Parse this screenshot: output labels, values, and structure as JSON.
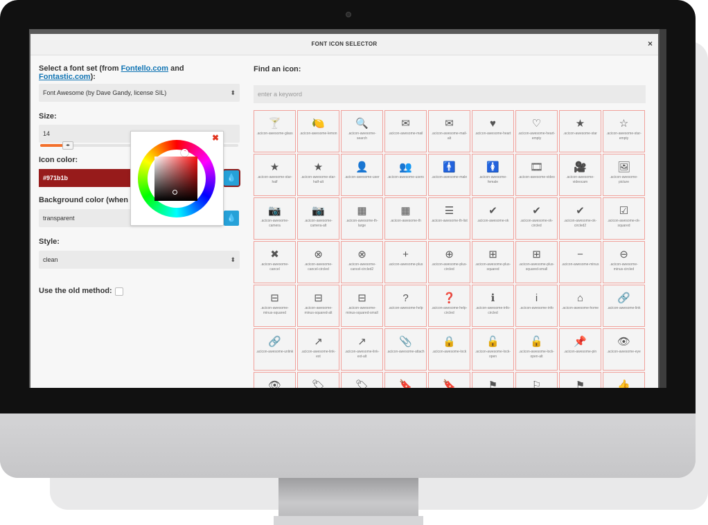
{
  "dialog": {
    "title": "FONT ICON SELECTOR",
    "close_glyph": "×"
  },
  "font_set": {
    "label_prefix": "Select a font set (from ",
    "link1": "Fontello.com",
    "label_mid": " and ",
    "link2": "Fontastic.com",
    "label_suffix": "):",
    "value": "Font Awesome (by Dave Gandy, license SIL)"
  },
  "size": {
    "label": "Size:",
    "value": "14",
    "slider_fraction": 0.15,
    "handle_glyph": "◂▸"
  },
  "icon_color": {
    "label": "Icon color:",
    "value": "#971b1b",
    "button_icon": "droplet-icon",
    "button_glyph": "💧"
  },
  "background_color": {
    "label": "Background color (when available):",
    "value": "transparent",
    "button_glyph": "💧"
  },
  "style": {
    "label": "Style:",
    "value": "clean"
  },
  "old_method": {
    "label": "Use the old method:",
    "checked": false
  },
  "picker": {
    "close_glyph": "✖"
  },
  "find": {
    "label": "Find an icon:",
    "placeholder": "enter a keyword"
  },
  "icons": [
    {
      "glyph": "🍸",
      "name": "glass"
    },
    {
      "glyph": "🍋",
      "name": "lemon"
    },
    {
      "glyph": "🔍",
      "name": "search"
    },
    {
      "glyph": "✉",
      "name": "mail"
    },
    {
      "glyph": "✉",
      "name": "mail-alt"
    },
    {
      "glyph": "♥",
      "name": "heart"
    },
    {
      "glyph": "♡",
      "name": "heart-empty"
    },
    {
      "glyph": "★",
      "name": "star"
    },
    {
      "glyph": "☆",
      "name": "star-empty"
    },
    {
      "glyph": "★",
      "name": "star-half"
    },
    {
      "glyph": "★",
      "name": "star-half-alt"
    },
    {
      "glyph": "👤",
      "name": "user"
    },
    {
      "glyph": "👥",
      "name": "users"
    },
    {
      "glyph": "🚹",
      "name": "male"
    },
    {
      "glyph": "🚺",
      "name": "female"
    },
    {
      "glyph": "🎞",
      "name": "video"
    },
    {
      "glyph": "🎥",
      "name": "videocam"
    },
    {
      "glyph": "🖼",
      "name": "picture"
    },
    {
      "glyph": "📷",
      "name": "camera"
    },
    {
      "glyph": "📷",
      "name": "camera-alt"
    },
    {
      "glyph": "▦",
      "name": "th-large"
    },
    {
      "glyph": "▦",
      "name": "th"
    },
    {
      "glyph": "☰",
      "name": "th-list"
    },
    {
      "glyph": "✔",
      "name": "ok"
    },
    {
      "glyph": "✔",
      "name": "ok-circled"
    },
    {
      "glyph": "✔",
      "name": "ok-circled2"
    },
    {
      "glyph": "☑",
      "name": "ok-squared"
    },
    {
      "glyph": "✖",
      "name": "cancel"
    },
    {
      "glyph": "⊗",
      "name": "cancel-circled"
    },
    {
      "glyph": "⊗",
      "name": "cancel-circled2"
    },
    {
      "glyph": "+",
      "name": "plus"
    },
    {
      "glyph": "⊕",
      "name": "plus-circled"
    },
    {
      "glyph": "⊞",
      "name": "plus-squared"
    },
    {
      "glyph": "⊞",
      "name": "plus-squared-small"
    },
    {
      "glyph": "−",
      "name": "minus"
    },
    {
      "glyph": "⊖",
      "name": "minus-circled"
    },
    {
      "glyph": "⊟",
      "name": "minus-squared"
    },
    {
      "glyph": "⊟",
      "name": "minus-squared-alt"
    },
    {
      "glyph": "⊟",
      "name": "minus-squared-small"
    },
    {
      "glyph": "?",
      "name": "help"
    },
    {
      "glyph": "❓",
      "name": "help-circled"
    },
    {
      "glyph": "ℹ",
      "name": "info-circled"
    },
    {
      "glyph": "i",
      "name": "info"
    },
    {
      "glyph": "⌂",
      "name": "home"
    },
    {
      "glyph": "🔗",
      "name": "link"
    },
    {
      "glyph": "🔗",
      "name": "unlink"
    },
    {
      "glyph": "↗",
      "name": "link-ext"
    },
    {
      "glyph": "↗",
      "name": "link-ext-alt"
    },
    {
      "glyph": "📎",
      "name": "attach"
    },
    {
      "glyph": "🔒",
      "name": "lock"
    },
    {
      "glyph": "🔓",
      "name": "lock-open"
    },
    {
      "glyph": "🔓",
      "name": "lock-open-alt"
    },
    {
      "glyph": "📌",
      "name": "pin"
    },
    {
      "glyph": "👁",
      "name": "eye"
    },
    {
      "glyph": "👁",
      "name": ""
    },
    {
      "glyph": "🏷",
      "name": ""
    },
    {
      "glyph": "🏷",
      "name": ""
    },
    {
      "glyph": "🔖",
      "name": ""
    },
    {
      "glyph": "🔖",
      "name": ""
    },
    {
      "glyph": "⚑",
      "name": ""
    },
    {
      "glyph": "⚐",
      "name": ""
    },
    {
      "glyph": "⚑",
      "name": ""
    },
    {
      "glyph": "👍",
      "name": ""
    }
  ],
  "icon_prefix": ".acicon-awesome-",
  "colors": {
    "accent": "#26a1d8",
    "selected_color": "#971b1b",
    "slider": "#f3702b",
    "cell_border": "#f0a09a"
  }
}
